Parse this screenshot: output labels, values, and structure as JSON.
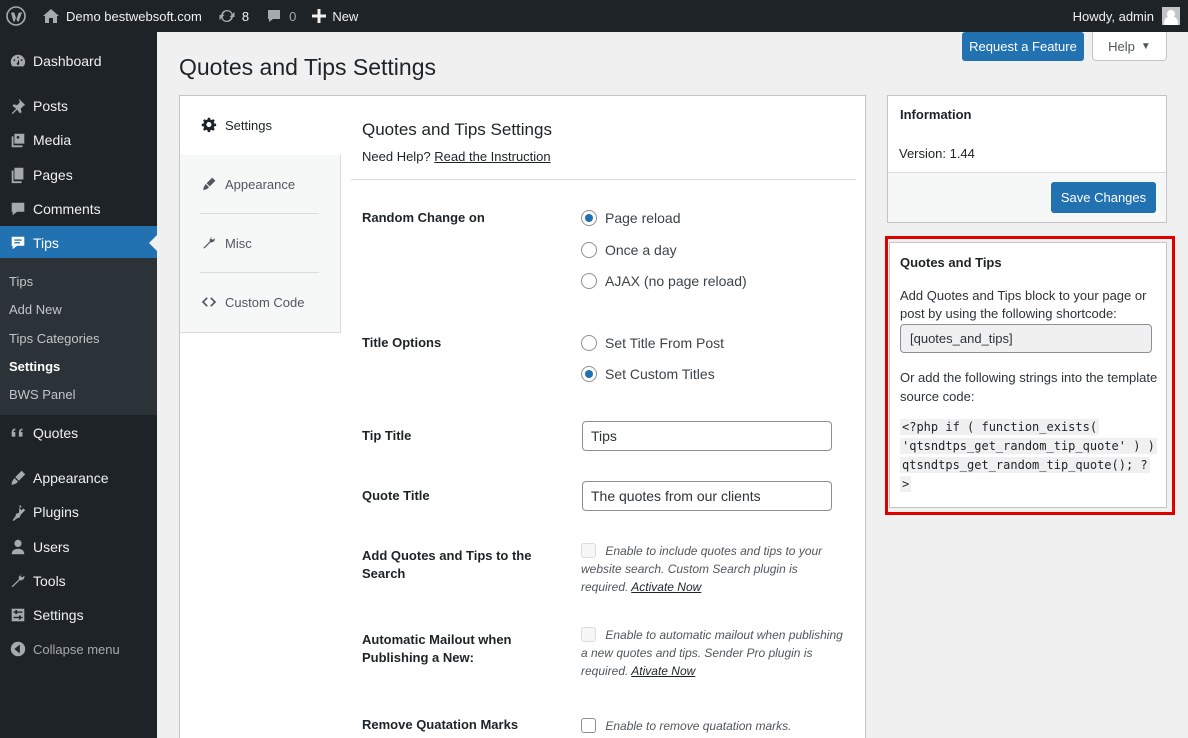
{
  "adminbar": {
    "site_name": "Demo bestwebsoft.com",
    "updates_count": "8",
    "comments_count": "0",
    "new_label": "New",
    "greeting": "Howdy, admin"
  },
  "sidebar": {
    "items": [
      {
        "label": "Dashboard",
        "icon": "dashboard-icon"
      },
      {
        "label": "Posts",
        "icon": "pin-icon"
      },
      {
        "label": "Media",
        "icon": "media-icon"
      },
      {
        "label": "Pages",
        "icon": "pages-icon"
      },
      {
        "label": "Comments",
        "icon": "comment-icon"
      },
      {
        "label": "Tips",
        "icon": "tips-icon"
      },
      {
        "label": "Quotes",
        "icon": "quote-icon"
      },
      {
        "label": "Appearance",
        "icon": "brush-icon"
      },
      {
        "label": "Plugins",
        "icon": "plugin-icon"
      },
      {
        "label": "Users",
        "icon": "user-icon"
      },
      {
        "label": "Tools",
        "icon": "wrench-icon"
      },
      {
        "label": "Settings",
        "icon": "settings-icon"
      },
      {
        "label": "Collapse menu",
        "icon": "collapse-icon"
      }
    ],
    "submenu": [
      "Tips",
      "Add New",
      "Tips Categories",
      "Settings",
      "BWS Panel"
    ]
  },
  "header": {
    "title": "Quotes and Tips Settings",
    "request_feature": "Request a Feature",
    "help": "Help"
  },
  "tabs": [
    "Settings",
    "Appearance",
    "Misc",
    "Custom Code"
  ],
  "content": {
    "title": "Quotes and Tips Settings",
    "help_prefix": "Need Help?",
    "help_link": "Read the Instruction",
    "random_change": {
      "label": "Random Change on",
      "options": [
        "Page reload",
        "Once a day",
        "AJAX (no page reload)"
      ],
      "selected": "Page reload"
    },
    "title_options": {
      "label": "Title Options",
      "options": [
        "Set Title From Post",
        "Set Custom Titles"
      ],
      "selected": "Set Custom Titles"
    },
    "tip_title": {
      "label": "Tip Title",
      "value": "Tips"
    },
    "quote_title": {
      "label": "Quote Title",
      "value": "The quotes from our clients"
    },
    "search": {
      "label": "Add Quotes and Tips to the Search",
      "text": "Enable to include quotes and tips to your website search. Custom Search plugin is required.",
      "link": "Activate Now"
    },
    "mailout": {
      "label": "Automatic Mailout when Publishing a New:",
      "text": "Enable to automatic mailout when publishing a new quotes and tips. Sender Pro plugin is required.",
      "link": "Ativate Now"
    },
    "quotation": {
      "label": "Remove Quatation Marks",
      "text": "Enable to remove quatation marks."
    }
  },
  "info": {
    "title": "Information",
    "version": "Version: 1.44",
    "save": "Save Changes"
  },
  "quotes_box": {
    "title": "Quotes and Tips",
    "text1": "Add Quotes and Tips block to your page or post by using the following shortcode:",
    "shortcode": "[quotes_and_tips]",
    "text2": "Or add the following strings into the template source code:",
    "code_lines": [
      "<?php if ( function_exists(",
      "'qtsndtps_get_random_tip_quote' ) )",
      "qtsndtps_get_random_tip_quote(); ?",
      ">"
    ]
  },
  "colors": {
    "adminbar_bg": "#1d2327",
    "accent": "#2271b1",
    "highlight": "#e00000"
  }
}
